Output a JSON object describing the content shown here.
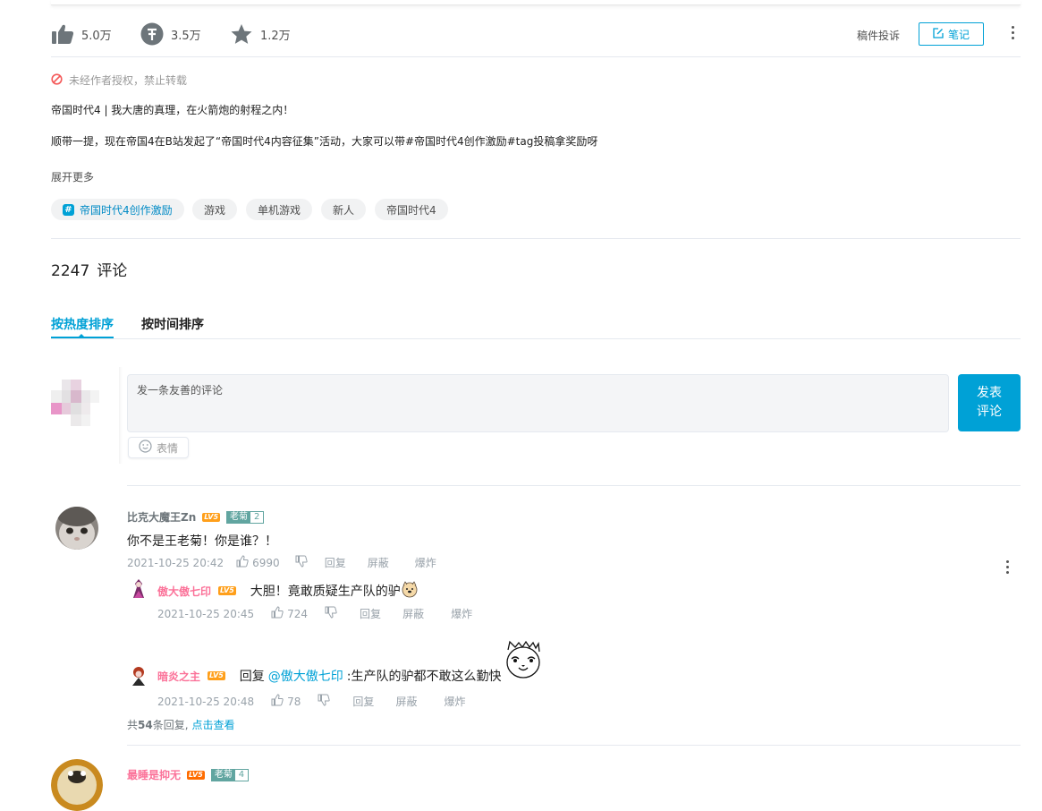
{
  "stats": {
    "likes": "5.0万",
    "coins": "3.5万",
    "favorites": "1.2万"
  },
  "toolbar": {
    "report": "稿件投诉",
    "notes": "笔记"
  },
  "description": {
    "copyright": "未经作者授权，禁止转载",
    "title": "帝国时代4 | 我大唐的真理，在火箭炮的射程之内！",
    "body": "顺带一提，现在帝国4在B站发起了“帝国时代4内容征集”活动，大家可以带#帝国时代4创作激励#tag投稿拿奖励呀",
    "expand": "展开更多"
  },
  "tags": [
    {
      "label": "帝国时代4创作激励",
      "topic": true
    },
    {
      "label": "游戏"
    },
    {
      "label": "单机游戏"
    },
    {
      "label": "新人"
    },
    {
      "label": "帝国时代4"
    }
  ],
  "comments_header": {
    "count": "2247",
    "label": "评论"
  },
  "sort_tabs": {
    "hot": "按热度排序",
    "time": "按时间排序"
  },
  "composer": {
    "placeholder": "发一条友善的评论",
    "emoji": "表情",
    "submit_line1": "发表",
    "submit_line2": "评论"
  },
  "comments": [
    {
      "user": "比克大魔王Zn",
      "level": "LV5",
      "medal_name": "老菊",
      "medal_level": "2",
      "text": "你不是王老菊！你是谁？！",
      "time": "2021-10-25 20:42",
      "likes": "6990",
      "actions": {
        "reply": "回复",
        "block": "屏蔽",
        "report": "爆炸"
      },
      "replies": [
        {
          "user": "傲大傲七印",
          "level": "LV5",
          "text": "大胆！竟敢质疑生产队的驴",
          "time": "2021-10-25 20:45",
          "likes": "724"
        },
        {
          "user": "暗炎之主",
          "level": "LV5",
          "reply_prefix": "回复",
          "at": "@傲大傲七印",
          "text": ":生产队的驴都不敢这么勤快",
          "time": "2021-10-25 20:48",
          "likes": "78"
        }
      ],
      "more_replies": {
        "prefix": "共",
        "count": "54",
        "suffix": "条回复,",
        "link": "点击查看"
      }
    },
    {
      "user": "最睡是抑无",
      "level": "LV5",
      "medal_name": "老菊",
      "medal_level": "4"
    }
  ]
}
